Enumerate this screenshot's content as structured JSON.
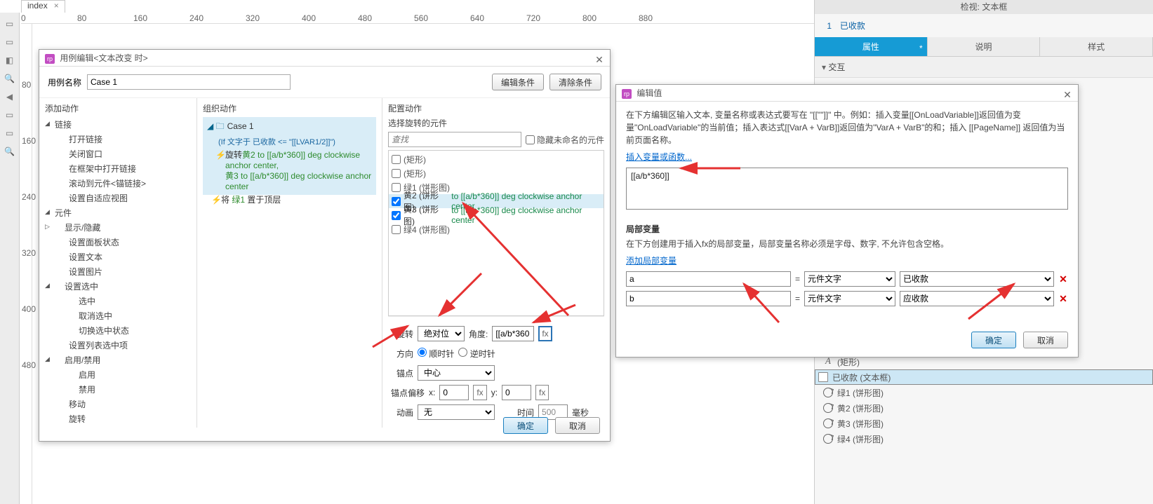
{
  "page_tab": "index",
  "ruler_ticks": [
    "0",
    "80",
    "160",
    "240",
    "320",
    "400",
    "480",
    "560",
    "640",
    "720",
    "800",
    "880"
  ],
  "ruler_v_ticks": [
    "80",
    "160",
    "240",
    "320",
    "400",
    "480"
  ],
  "inspector": {
    "top_label": "检视: 文本框",
    "page_num": "1",
    "page_name": "已收款",
    "tabs": {
      "props": "属性",
      "notes": "说明",
      "style": "样式",
      "dirty": "*"
    },
    "section_interaction": "交互",
    "outline": [
      {
        "label": "(矩形)",
        "icon": "textbox"
      },
      {
        "label": "已收款 (文本框)",
        "icon": "rect",
        "selected": true
      },
      {
        "label": "绿1 (饼形图)",
        "icon": "circle"
      },
      {
        "label": "黄2 (饼形图)",
        "icon": "circle"
      },
      {
        "label": "黄3 (饼形图)",
        "icon": "circle"
      },
      {
        "label": "绿4 (饼形图)",
        "icon": "circle"
      }
    ]
  },
  "dlg1": {
    "title": "用例编辑<文本改变 时>",
    "case_name_label": "用例名称",
    "case_name_value": "Case 1",
    "btn_edit_cond": "编辑条件",
    "btn_clear_cond": "清除条件",
    "col1_hdr": "添加动作",
    "col2_hdr": "组织动作",
    "col3_hdr": "配置动作",
    "actions_tree": {
      "links": {
        "label": "链接",
        "items": [
          "打开链接",
          "关闭窗口",
          "在框架中打开链接",
          "滚动到元件<锚链接>",
          "设置自适应视图"
        ]
      },
      "widgets": {
        "label": "元件",
        "show_hide": {
          "label": "显示/隐藏"
        },
        "items1": [
          "设置面板状态",
          "设置文本",
          "设置图片"
        ],
        "set_sel": {
          "label": "设置选中",
          "items": [
            "选中",
            "取消选中",
            "切换选中状态"
          ]
        },
        "items2": [
          "设置列表选中项"
        ],
        "enable": {
          "label": "启用/禁用",
          "items": [
            "启用",
            "禁用"
          ]
        },
        "items3": [
          "移动",
          "旋转"
        ]
      }
    },
    "case": {
      "name": "Case 1",
      "cond": "(If 文字于 已收款 <= \"[[LVAR1/2]]\")",
      "act1_pre": "旋转",
      "act1_g1": "黄2 to [[a/b*360]] deg clockwise anchor center,",
      "act1_g2": "黄3 to [[a/b*360]] deg clockwise anchor center",
      "act2_pre": "将",
      "act2_g": "绿1",
      "act2_suf": " 置于顶层"
    },
    "panel": {
      "label": "选择旋转的元件",
      "search_ph": "查找",
      "hide_unnamed": "隐藏未命名的元件",
      "rows": [
        {
          "checked": false,
          "label": "(矩形)"
        },
        {
          "checked": false,
          "label": "(矩形)"
        },
        {
          "checked": false,
          "label": "绿1 (饼形图)"
        },
        {
          "checked": true,
          "label": "黄2 (饼形图)",
          "suffix": " to [[a/b*360]] deg clockwise anchor center"
        },
        {
          "checked": true,
          "label": "黄3 (饼形图)",
          "suffix": " to [[a/b*360]] deg clockwise anchor center"
        },
        {
          "checked": false,
          "label": "绿4 (饼形图)"
        }
      ],
      "rotate_label": "旋转",
      "rotate_mode": "绝对位",
      "angle_label": "角度:",
      "angle_val": "[[a/b*360",
      "dir_label": "方向",
      "dir_cw": "顺时针",
      "dir_ccw": "逆时针",
      "anchor_label": "锚点",
      "anchor_val": "中心",
      "offset_label": "锚点偏移",
      "offset_x": "0",
      "offset_y": "0",
      "anim_label": "动画",
      "anim_val": "无",
      "time_label": "时间",
      "time_val": "500",
      "time_unit": "毫秒",
      "fx": "fx"
    },
    "ok": "确定",
    "cancel": "取消"
  },
  "dlg2": {
    "title": "编辑值",
    "help1": "在下方编辑区输入文本, 变量名称或表达式要写在 \"[[\"\"]]\" 中。例如：插入变量[[OnLoadVariable]]返回值为变量\"OnLoadVariable\"的当前值；插入表达式[[VarA + VarB]]返回值为\"VarA + VarB\"的和；插入 [[PageName]] 返回值为当前页面名称。",
    "insert_link": "插入变量或函数...",
    "editor_value": "[[a/b*360]]",
    "local_hdr": "局部变量",
    "local_help": "在下方创建用于插入fx的局部变量，局部变量名称必须是字母、数字, 不允许包含空格。",
    "add_local": "添加局部变量",
    "rows": [
      {
        "name": "a",
        "type": "元件文字",
        "widget": "已收款"
      },
      {
        "name": "b",
        "type": "元件文字",
        "widget": "应收款"
      }
    ],
    "ok": "确定",
    "cancel": "取消"
  }
}
